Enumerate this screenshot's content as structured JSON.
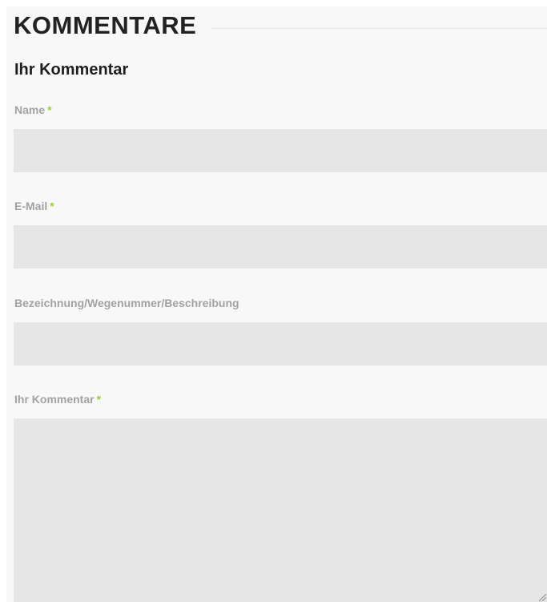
{
  "section": {
    "title": "KOMMENTARE"
  },
  "form": {
    "title": "Ihr Kommentar",
    "required_marker": "*",
    "fields": {
      "name": {
        "label": "Name",
        "value": ""
      },
      "email": {
        "label": "E-Mail",
        "value": ""
      },
      "description": {
        "label": "Bezeichnung/Wegenummer/Beschreibung",
        "value": ""
      },
      "comment": {
        "label": "Ihr Kommentar",
        "value": ""
      }
    }
  },
  "colors": {
    "panel_background": "#f8f8f8",
    "input_background": "#e6e6e6",
    "label_text": "#a2a2a2",
    "required_marker": "#9acd32",
    "heading_text": "#222222"
  },
  "icons": {
    "textarea_resize": "resize-handle-icon"
  }
}
